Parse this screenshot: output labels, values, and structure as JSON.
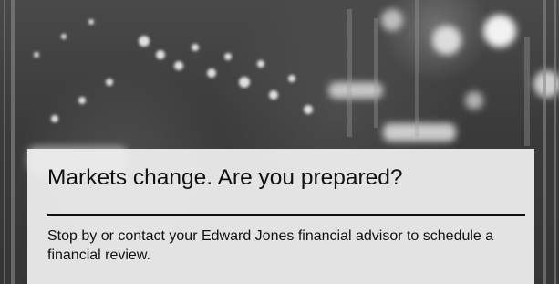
{
  "ad": {
    "headline": "Markets change. Are you prepared?",
    "body": "Stop by or contact your Edward Jones financial advisor to schedule a financial review."
  }
}
